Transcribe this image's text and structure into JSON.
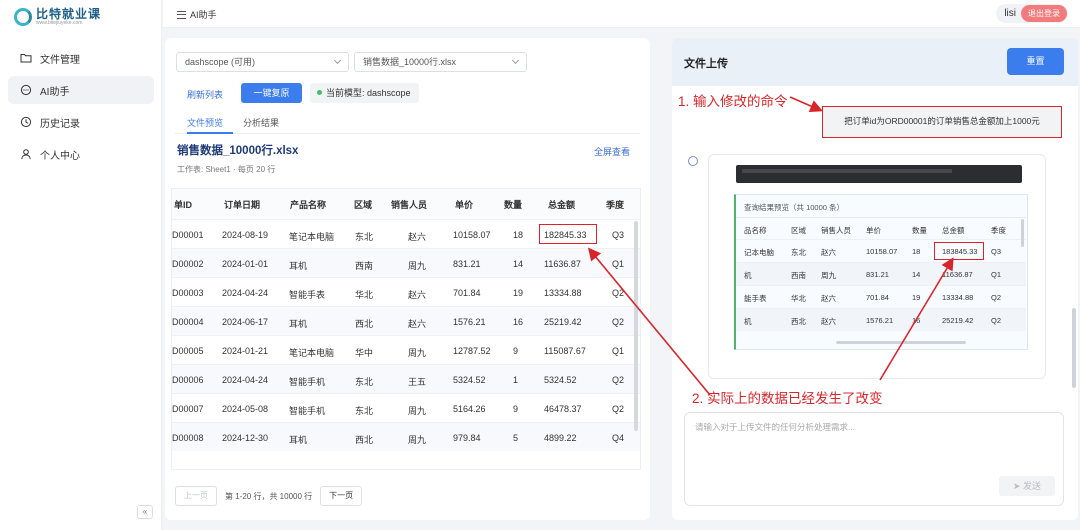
{
  "logo": {
    "name": "比特就业课",
    "sub": "www.bitejiuyeke.com"
  },
  "nav": [
    {
      "label": "文件管理",
      "icon": "folder-icon"
    },
    {
      "label": "AI助手",
      "icon": "chat-icon"
    },
    {
      "label": "历史记录",
      "icon": "clock-icon"
    },
    {
      "label": "个人中心",
      "icon": "user-icon"
    }
  ],
  "collapse_label": "«",
  "breadcrumb": "AI助手",
  "user": {
    "name": "lisi",
    "logout": "退出登录"
  },
  "controls": {
    "provider": "dashscope (可用)",
    "file": "销售数据_10000行.xlsx",
    "refresh": "刷新列表",
    "restore": "一键复原",
    "model": "当前模型: dashscope"
  },
  "tabs": [
    "文件预览",
    "分析结果"
  ],
  "preview": {
    "title": "销售数据_10000行.xlsx",
    "meta": "工作表: Sheet1 · 每页 20 行",
    "fullscreen": "全屏查看",
    "columns": [
      "单ID",
      "订单日期",
      "产品名称",
      "区域",
      "销售人员",
      "单价",
      "数量",
      "总金额",
      "季度"
    ],
    "rows": [
      [
        "D00001",
        "2024-08-19",
        "笔记本电脑",
        "东北",
        "赵六",
        "10158.07",
        "18",
        "182845.33",
        "Q3"
      ],
      [
        "D00002",
        "2024-01-01",
        "耳机",
        "西南",
        "周九",
        "831.21",
        "14",
        "11636.87",
        "Q1"
      ],
      [
        "D00003",
        "2024-04-24",
        "智能手表",
        "华北",
        "赵六",
        "701.84",
        "19",
        "13334.88",
        "Q2"
      ],
      [
        "D00004",
        "2024-06-17",
        "耳机",
        "西北",
        "赵六",
        "1576.21",
        "16",
        "25219.42",
        "Q2"
      ],
      [
        "D00005",
        "2024-01-21",
        "笔记本电脑",
        "华中",
        "周九",
        "12787.52",
        "9",
        "115087.67",
        "Q1"
      ],
      [
        "D00006",
        "2024-04-24",
        "智能手机",
        "东北",
        "王五",
        "5324.52",
        "1",
        "5324.52",
        "Q2"
      ],
      [
        "D00007",
        "2024-05-08",
        "智能手机",
        "东北",
        "周九",
        "5164.26",
        "9",
        "46478.37",
        "Q2"
      ],
      [
        "D00008",
        "2024-12-30",
        "耳机",
        "西北",
        "周九",
        "979.84",
        "5",
        "4899.22",
        "Q4"
      ]
    ]
  },
  "pager": {
    "prev": "上一页",
    "info": "第 1-20 行，共 10000 行",
    "next": "下一页"
  },
  "upload": {
    "title": "文件上传",
    "reset": "重置"
  },
  "annotations": {
    "step1": "1. 输入修改的命令",
    "step2": "2. 实际上的数据已经发生了改变"
  },
  "command": "把订单id为ORD00001的订单销售总金额加上1000元",
  "result": {
    "title": "查询结果预览（共 10000 条）",
    "columns": [
      "品名称",
      "区域",
      "销售人员",
      "单价",
      "数量",
      "总金额",
      "季度"
    ],
    "rows": [
      [
        "记本电脑",
        "东北",
        "赵六",
        "10158.07",
        "18",
        "183845.33",
        "Q3"
      ],
      [
        "机",
        "西南",
        "周九",
        "831.21",
        "14",
        "11636.87",
        "Q1"
      ],
      [
        "能手表",
        "华北",
        "赵六",
        "701.84",
        "19",
        "13334.88",
        "Q2"
      ],
      [
        "机",
        "西北",
        "赵六",
        "1576.21",
        "16",
        "25219.42",
        "Q2"
      ]
    ]
  },
  "input": {
    "placeholder": "请输入对于上传文件的任何分析处理需求...",
    "send": "发送"
  },
  "colors": {
    "accent": "#3b7ded",
    "annotation": "#d9252a",
    "success": "#3fbf6a"
  }
}
